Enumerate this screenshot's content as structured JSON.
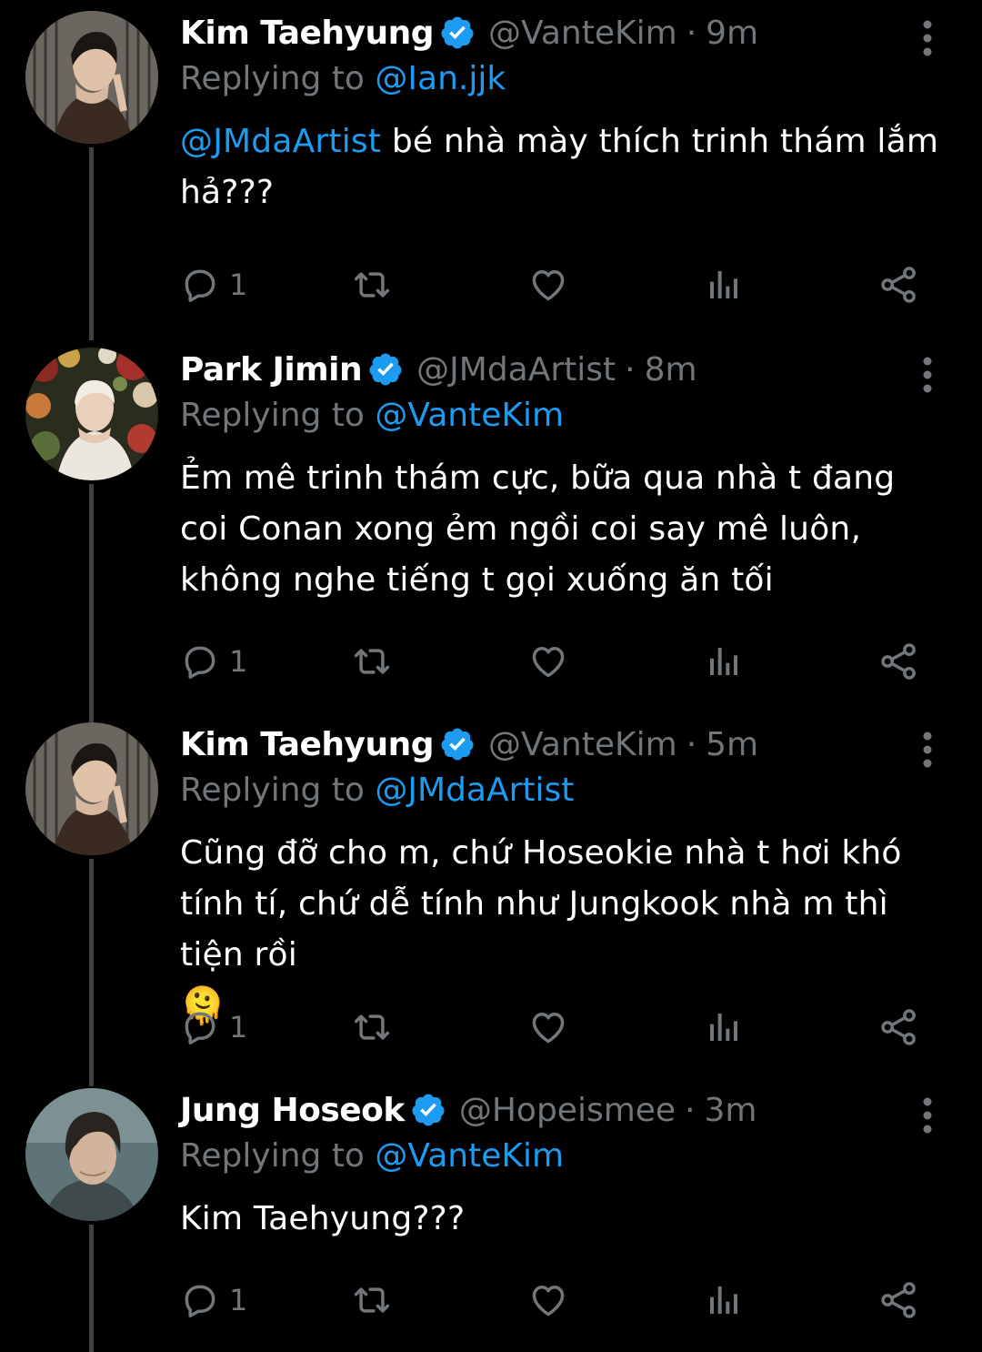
{
  "tweets": [
    {
      "name": "Kim Taehyung",
      "handle": "@VanteKim",
      "separator": "·",
      "time": "9m",
      "replying_prefix": "Replying to ",
      "replying_to": "@Ian.jjk",
      "text_mention": "@JMdaArtist",
      "text": " bé nhà mày thích trinh thám lắm hả???",
      "reply_count": "1"
    },
    {
      "name": "Park Jimin",
      "handle": "@JMdaArtist",
      "separator": "·",
      "time": "8m",
      "replying_prefix": "Replying to ",
      "replying_to": "@VanteKim",
      "text": "Ẻm mê trinh thám cực, bữa qua nhà t đang coi Conan xong ẻm ngồi coi say mê luôn, không nghe tiếng t gọi xuống ăn tối",
      "reply_count": "1"
    },
    {
      "name": "Kim Taehyung",
      "handle": "@VanteKim",
      "separator": "·",
      "time": "5m",
      "replying_prefix": "Replying to ",
      "replying_to": "@JMdaArtist",
      "text": "Cũng đỡ cho m, chứ Hoseokie nhà t hơi khó tính tí, chứ dễ tính như Jungkook nhà m thì tiện rồi",
      "emoji": "🫠",
      "reply_count": "1"
    },
    {
      "name": "Jung Hoseok",
      "handle": "@Hopeismee",
      "separator": "·",
      "time": "3m",
      "replying_prefix": "Replying to ",
      "replying_to": "@VanteKim",
      "text": "Kim Taehyung???",
      "reply_count": "1"
    }
  ],
  "colors": {
    "background": "#000000",
    "text": "#ffffff",
    "muted": "#71767b",
    "accent": "#1d9bf0",
    "thread_line": "#3e4144"
  },
  "icons": {
    "reply": "reply-icon",
    "retweet": "retweet-icon",
    "like": "heart-icon",
    "views": "views-icon",
    "share": "share-icon",
    "more": "more-icon",
    "verified": "verified-badge-icon"
  }
}
